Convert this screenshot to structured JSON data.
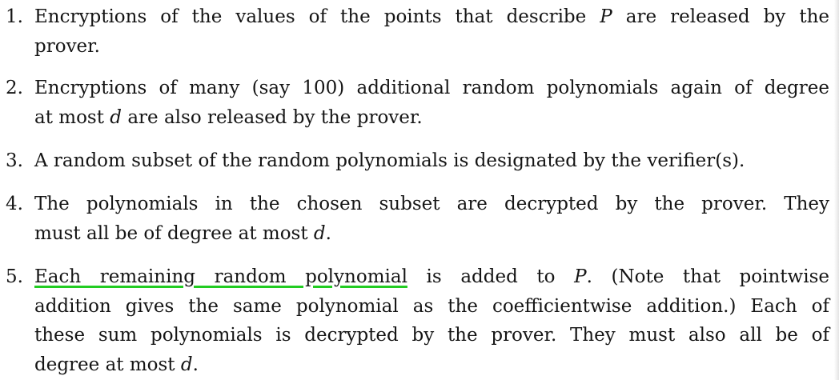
{
  "items": [
    {
      "number": "1.",
      "lines": [
        [
          "Encryptions of the values of the points that describe ",
          {
            "math": "P"
          },
          " are released by the"
        ],
        [
          "prover."
        ]
      ]
    },
    {
      "number": "2.",
      "lines": [
        [
          "Encryptions of many (say 100) additional random polynomials again of degree"
        ],
        [
          "at most ",
          {
            "math": "d"
          },
          " are also released by the prover."
        ]
      ]
    },
    {
      "number": "3.",
      "lines": [
        [
          "A random subset of the random polynomials is designated by the verifier(s)."
        ]
      ]
    },
    {
      "number": "4.",
      "lines": [
        [
          "The polynomials in the chosen subset are decrypted by the prover.  They"
        ],
        [
          "must all be of degree at most ",
          {
            "math": "d"
          },
          "."
        ]
      ]
    },
    {
      "number": "5.",
      "lines": [
        [
          {
            "highlight": "Each remaining random polynomial"
          },
          " is added to ",
          {
            "math": "P"
          },
          ".  (Note that pointwise"
        ],
        [
          "addition gives the same polynomial as the coefficientwise addition.)  Each of"
        ],
        [
          "these sum polynomials is decrypted by the prover. They must also all be of"
        ],
        [
          "degree at most ",
          {
            "math": "d"
          },
          "."
        ]
      ]
    }
  ],
  "colors": {
    "text": "#151515",
    "highlight_underline": "#22cc22",
    "background": "#ffffff"
  }
}
